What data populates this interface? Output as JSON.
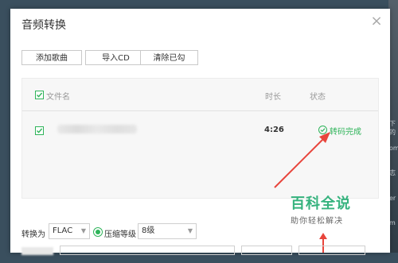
{
  "dialog": {
    "title": "音频转换",
    "close_icon": "close-icon"
  },
  "toolbar": {
    "add_song_label": "添加歌曲",
    "import_cd_label": "导入CD",
    "clear_checked_label": "清除已勾"
  },
  "list": {
    "headers": {
      "filename": "文件名",
      "duration": "时长",
      "status": "状态"
    },
    "rows": [
      {
        "filename": "",
        "duration": "4:26",
        "status": "转码完成",
        "checked": true
      }
    ]
  },
  "watermark": {
    "title": "百科全说",
    "subtitle": "助你轻松解决"
  },
  "options": {
    "convert_to_label": "转换为",
    "format_value": "FLAC",
    "compression_label": "压缩等级",
    "compression_value": "8级"
  },
  "colors": {
    "accent": "#2fb45a",
    "arrow": "#e8453c"
  }
}
